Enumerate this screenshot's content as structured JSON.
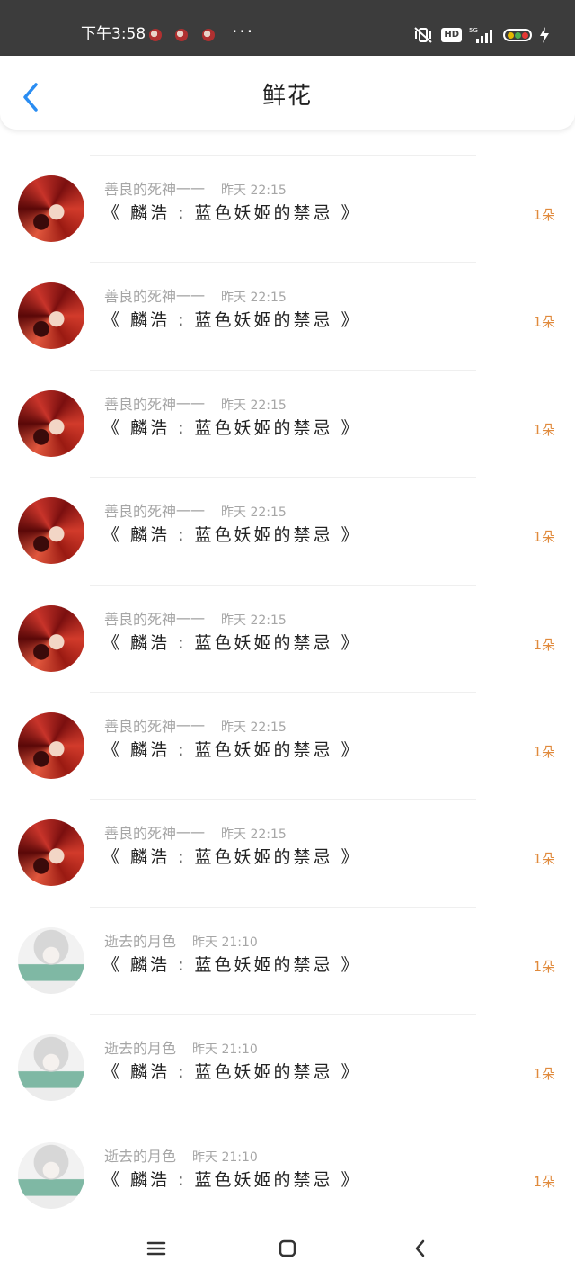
{
  "status_bar": {
    "time": "下午3:58",
    "more": "···",
    "hd": "HD",
    "network": "5G",
    "battery_colors": [
      "#e6b800",
      "#4caf50",
      "#e53935"
    ]
  },
  "header": {
    "title": "鲜花",
    "back_icon": "chevron-left-icon",
    "accent": "#2a8df2"
  },
  "flowers": [
    {
      "user": "善良的死神一一",
      "time": "昨天 22:15",
      "book": "《 麟浩 : 蓝色妖姬的禁忌 》",
      "count": "1朵",
      "avatar": "red"
    },
    {
      "user": "善良的死神一一",
      "time": "昨天 22:15",
      "book": "《 麟浩 : 蓝色妖姬的禁忌 》",
      "count": "1朵",
      "avatar": "red"
    },
    {
      "user": "善良的死神一一",
      "time": "昨天 22:15",
      "book": "《 麟浩 : 蓝色妖姬的禁忌 》",
      "count": "1朵",
      "avatar": "red"
    },
    {
      "user": "善良的死神一一",
      "time": "昨天 22:15",
      "book": "《 麟浩 : 蓝色妖姬的禁忌 》",
      "count": "1朵",
      "avatar": "red"
    },
    {
      "user": "善良的死神一一",
      "time": "昨天 22:15",
      "book": "《 麟浩 : 蓝色妖姬的禁忌 》",
      "count": "1朵",
      "avatar": "red"
    },
    {
      "user": "善良的死神一一",
      "time": "昨天 22:15",
      "book": "《 麟浩 : 蓝色妖姬的禁忌 》",
      "count": "1朵",
      "avatar": "red"
    },
    {
      "user": "善良的死神一一",
      "time": "昨天 22:15",
      "book": "《 麟浩 : 蓝色妖姬的禁忌 》",
      "count": "1朵",
      "avatar": "red"
    },
    {
      "user": "逝去的月色",
      "time": "昨天 21:10",
      "book": "《 麟浩 : 蓝色妖姬的禁忌 》",
      "count": "1朵",
      "avatar": "gray"
    },
    {
      "user": "逝去的月色",
      "time": "昨天 21:10",
      "book": "《 麟浩 : 蓝色妖姬的禁忌 》",
      "count": "1朵",
      "avatar": "gray"
    },
    {
      "user": "逝去的月色",
      "time": "昨天 21:10",
      "book": "《 麟浩 : 蓝色妖姬的禁忌 》",
      "count": "1朵",
      "avatar": "gray"
    }
  ],
  "count_color": "#e08a3c",
  "nav": {
    "menu_icon": "menu-icon",
    "home_icon": "home-square-icon",
    "back_icon": "back-chevron-icon"
  }
}
